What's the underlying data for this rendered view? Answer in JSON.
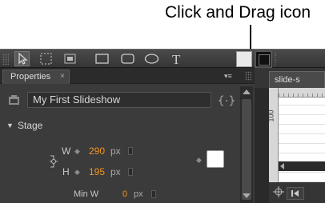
{
  "callout": {
    "text": "Click and Drag icon"
  },
  "toolbar": {
    "tools": [
      "select-arrow-icon",
      "marquee-select-icon",
      "crop-icon",
      "rectangle-icon",
      "rounded-rectangle-icon",
      "ellipse-icon",
      "text-icon"
    ],
    "fill_color": "#e9e9e9",
    "stroke_color": "#111111"
  },
  "properties": {
    "tab_label": "Properties",
    "close_glyph": "×",
    "menu_glyph": "▾≡",
    "document_name": "My First Slideshow",
    "section_label": "Stage",
    "width": {
      "label": "W",
      "value": "290",
      "unit": "px"
    },
    "height": {
      "label": "H",
      "value": "195",
      "unit": "px"
    },
    "min_width": {
      "label": "Min W",
      "value": "0",
      "unit": "px"
    },
    "stage_color": "#ffffff"
  },
  "right_panel": {
    "tab_label": "slide-s",
    "ruler_label": "100"
  },
  "colors": {
    "accent_value": "#f29321",
    "panel_bg": "#3b3b3b"
  }
}
